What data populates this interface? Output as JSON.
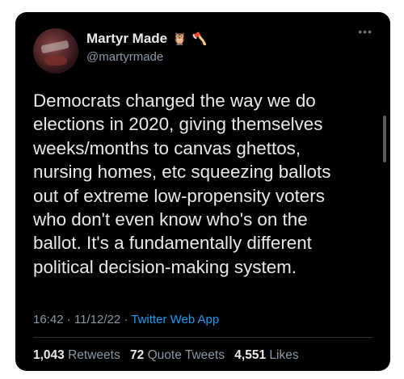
{
  "author": {
    "display_name": "Martyr Made",
    "handle": "@martyrmade",
    "badges": [
      "owl-emoji",
      "axe-emoji"
    ]
  },
  "more_menu_icon": "more-horizontal-icon",
  "tweet": {
    "text": "Democrats changed the way we do\nelections in 2020, giving themselves\nweeks/months to canvas ghettos,\nnursing homes, etc squeezing ballots\nout of extreme low-propensity voters\nwho don't even know who's on the\nballot. It's a fundamentally different\npolitical decision-making system.",
    "time": "16:42",
    "date": "11/12/22",
    "separator": "·",
    "source": "Twitter Web App"
  },
  "stats": {
    "retweets_count": "1,043",
    "retweets_label": "Retweets",
    "quotes_count": "72",
    "quotes_label": "Quote Tweets",
    "likes_count": "4,551",
    "likes_label": "Likes"
  },
  "colors": {
    "background": "#000000",
    "text": "#e7e9ea",
    "secondary": "#8b98a5",
    "link": "#1d9bf0"
  }
}
